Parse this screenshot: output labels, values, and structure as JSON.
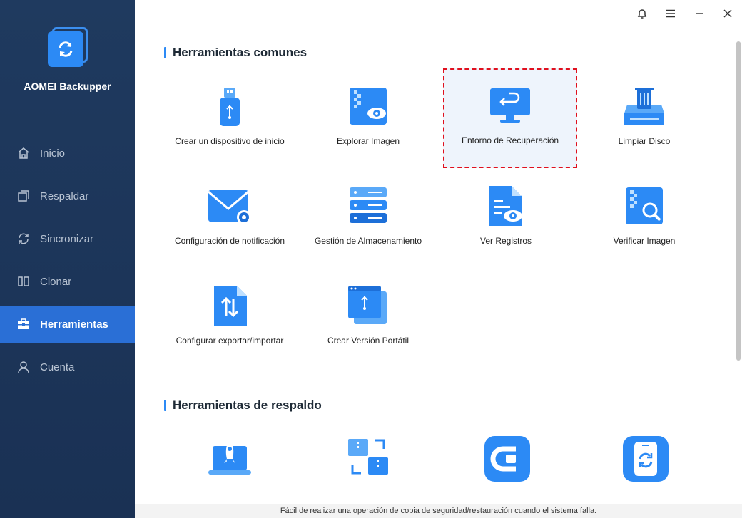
{
  "app": {
    "name": "AOMEI Backupper"
  },
  "sidebar": {
    "items": [
      {
        "label": "Inicio",
        "icon": "home-icon",
        "active": false
      },
      {
        "label": "Respaldar",
        "icon": "backup-icon",
        "active": false
      },
      {
        "label": "Sincronizar",
        "icon": "sync-icon",
        "active": false
      },
      {
        "label": "Clonar",
        "icon": "clone-icon",
        "active": false
      },
      {
        "label": "Herramientas",
        "icon": "toolbox-icon",
        "active": true
      },
      {
        "label": "Cuenta",
        "icon": "user-icon",
        "active": false
      }
    ]
  },
  "window_controls": [
    "bell-icon",
    "menu-icon",
    "minimize-icon",
    "close-icon"
  ],
  "sections": {
    "common": {
      "title": "Herramientas comunes",
      "tools": [
        {
          "label": "Crear un dispositivo de inicio",
          "icon": "usb-drive-icon"
        },
        {
          "label": "Explorar Imagen",
          "icon": "explore-image-icon"
        },
        {
          "label": "Entorno de Recuperación",
          "icon": "recovery-monitor-icon",
          "highlighted": true
        },
        {
          "label": "Limpiar Disco",
          "icon": "disk-wipe-icon"
        },
        {
          "label": "Configuración de notificación",
          "icon": "mail-settings-icon"
        },
        {
          "label": "Gestión de Almacenamiento",
          "icon": "storage-server-icon"
        },
        {
          "label": "Ver Registros",
          "icon": "view-logs-icon"
        },
        {
          "label": "Verificar Imagen",
          "icon": "verify-image-icon"
        },
        {
          "label": "Configurar exportar/importar",
          "icon": "export-import-icon"
        },
        {
          "label": "Crear Versión Portátil",
          "icon": "portable-version-icon"
        }
      ]
    },
    "backup": {
      "title": "Herramientas de respaldo",
      "tools": [
        {
          "icon": "laptop-rocket-icon"
        },
        {
          "icon": "image-convert-icon"
        },
        {
          "icon": "cyber-backup-icon"
        },
        {
          "icon": "phone-backup-icon"
        }
      ]
    }
  },
  "status": {
    "text": "Fácil de realizar una operación de copia de seguridad/restauración cuando el sistema falla."
  },
  "colors": {
    "sidebar_bg": "#1f3a5f",
    "accent": "#2a6fd6",
    "icon_blue": "#2c8af5",
    "highlight_border": "#e0101e"
  }
}
